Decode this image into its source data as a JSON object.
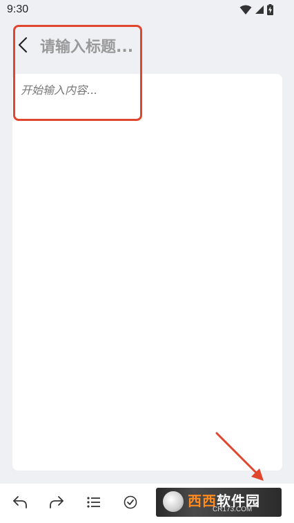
{
  "status_bar": {
    "time": "9:30",
    "icons": [
      "wifi-icon",
      "signal-icon",
      "battery-charging-icon"
    ]
  },
  "header": {
    "back_icon": "chevron-left-icon",
    "title_placeholder": "请输入标题..."
  },
  "editor": {
    "content_placeholder": "开始输入内容..."
  },
  "toolbar": {
    "items": [
      {
        "name": "undo",
        "icon": "undo-icon"
      },
      {
        "name": "redo",
        "icon": "redo-icon"
      },
      {
        "name": "list",
        "icon": "list-icon"
      },
      {
        "name": "checklist",
        "icon": "check-circle-icon"
      }
    ]
  },
  "watermark": {
    "main_part1": "西西",
    "main_part2": "软件园",
    "sub": "CR173.COM"
  },
  "colors": {
    "background": "#eff0f4",
    "card": "#ffffff",
    "highlight": "#e0452e",
    "placeholder": "#999999"
  }
}
